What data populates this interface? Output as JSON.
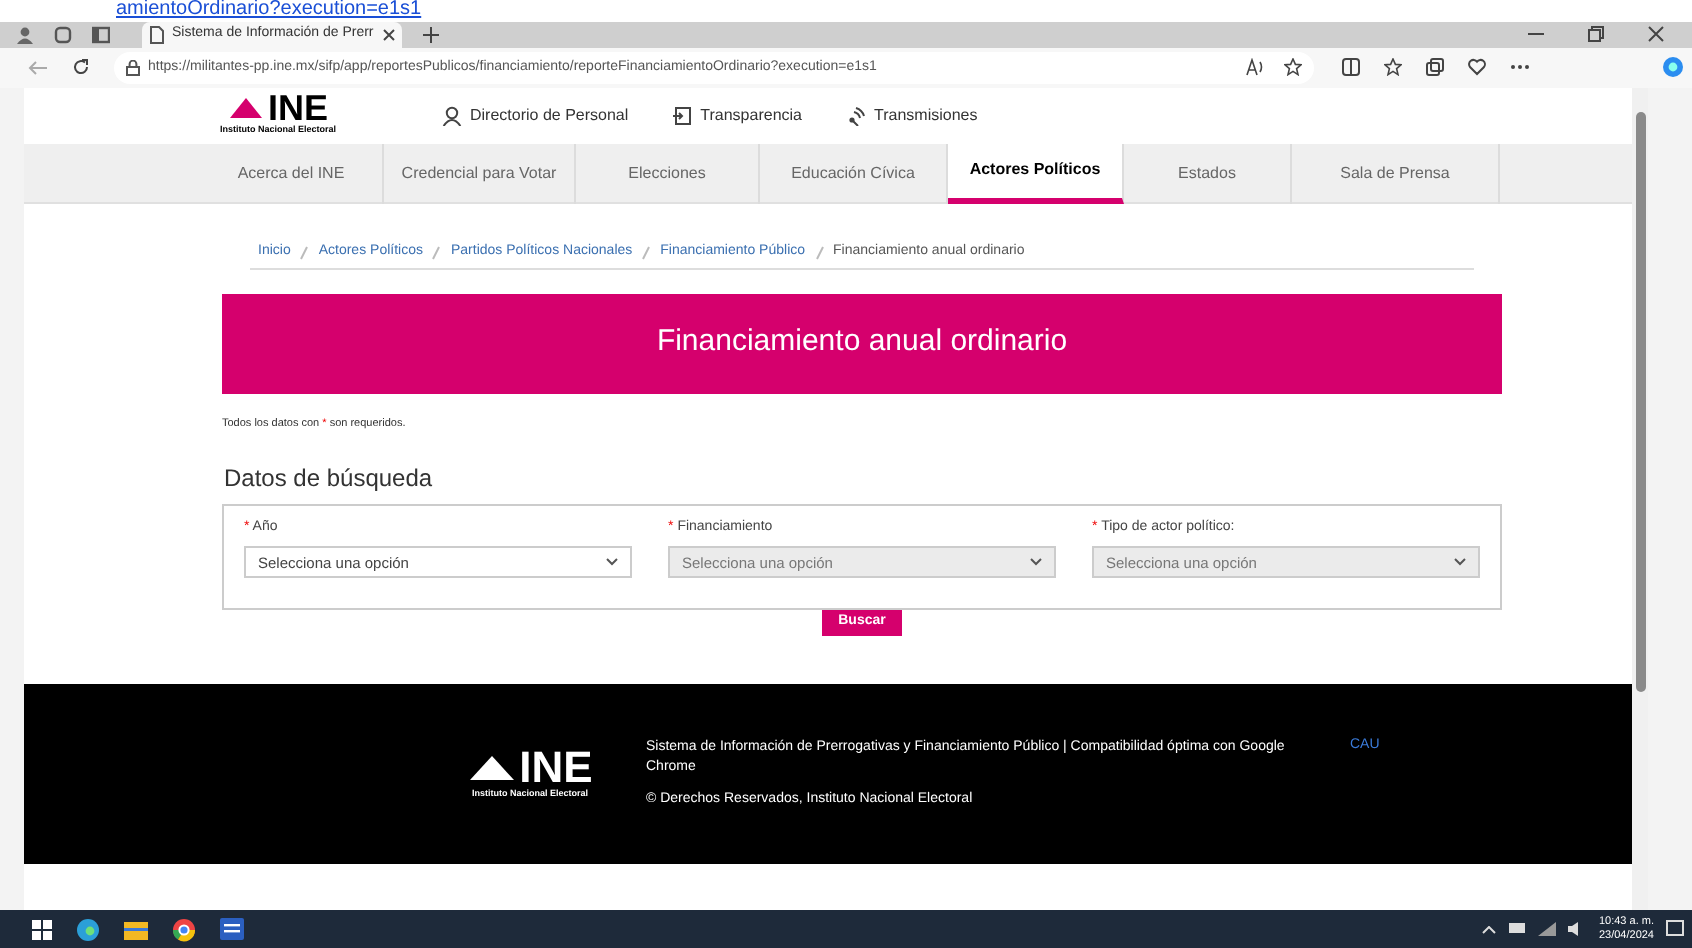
{
  "top_link": "amientoOrdinario?execution=e1s1",
  "browser": {
    "tab_title": "Sistema de Información de Prerr",
    "url_host": "https://militantes-pp.ine.mx",
    "url_path": "/sifp/app/reportesPublicos/financiamiento/reporteFinanciamientoOrdinario?execution=e1s1"
  },
  "header": {
    "logo": "INE",
    "logo_caption": "Instituto Nacional Electoral",
    "links": [
      {
        "label": "Directorio de Personal",
        "kind": "person"
      },
      {
        "label": "Transparencia",
        "kind": "doc"
      },
      {
        "label": "Transmisiones",
        "kind": "antenna"
      }
    ]
  },
  "nav": [
    {
      "label": "Acerca del INE",
      "selected": false
    },
    {
      "label": "Credencial para Votar",
      "selected": false
    },
    {
      "label": "Elecciones",
      "selected": false
    },
    {
      "label": "Educación Cívica",
      "selected": false
    },
    {
      "label": "Actores Políticos",
      "selected": true
    },
    {
      "label": "Estados",
      "selected": false
    },
    {
      "label": "Sala de Prensa",
      "selected": false
    }
  ],
  "breadcrumb": [
    {
      "label": "Inicio",
      "kind": "link"
    },
    {
      "label": "Actores Políticos",
      "kind": "link"
    },
    {
      "label": "Partidos Políticos Nacionales",
      "kind": "link"
    },
    {
      "label": "Financiamiento Público",
      "kind": "link"
    },
    {
      "label": "Financiamiento anual ordinario",
      "kind": "current"
    }
  ],
  "banner": "Financiamiento anual ordinario",
  "required_note": {
    "before": "Todos los datos con",
    "mark": "*",
    "after": "son requeridos."
  },
  "search": {
    "title": "Datos de búsqueda",
    "fields": [
      {
        "label": "Año",
        "required": true,
        "value": "Selecciona una opción",
        "disabled": false
      },
      {
        "label": "Financiamiento",
        "required": true,
        "value": "Selecciona una opción",
        "disabled": true
      },
      {
        "label": "Tipo de actor político:",
        "required": true,
        "value": "Selecciona una opción",
        "disabled": true
      }
    ],
    "button": "Buscar"
  },
  "footer": {
    "logo": "INE",
    "logo_caption": "Instituto Nacional Electoral",
    "description": "Sistema de Información de Prerrogativas y Financiamiento Público | Compatibilidad óptima con Google Chrome",
    "link": "CAU",
    "copyright": "© Derechos Reservados, Instituto Nacional Electoral"
  },
  "taskbar": {
    "time": "10:43 a. m.",
    "date": "23/04/2024"
  }
}
